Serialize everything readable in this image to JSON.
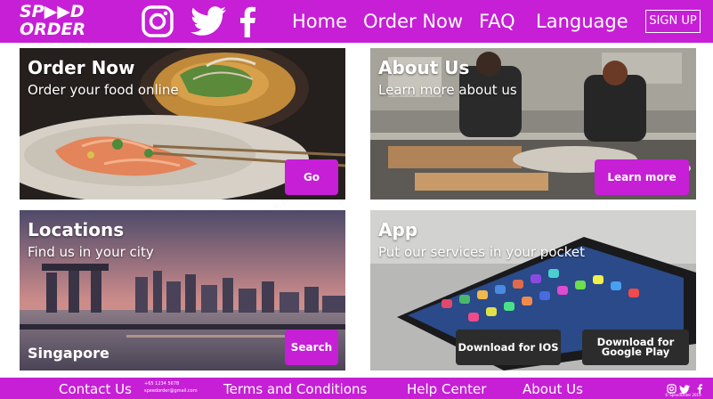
{
  "brand": {
    "logo_line1": "SP▶▶D",
    "logo_line2": "ORDER"
  },
  "header": {
    "social": [
      "instagram-icon",
      "twitter-icon",
      "facebook-icon"
    ],
    "nav": [
      "Home",
      "Order Now",
      "FAQ",
      "Language"
    ],
    "signup": "SIGN UP"
  },
  "cards": {
    "order": {
      "title": "Order Now",
      "subtitle": "Order your food online",
      "button": "Go"
    },
    "about": {
      "title": "About Us",
      "subtitle": "Learn more about us",
      "button": "Learn more"
    },
    "locations": {
      "title": "Locations",
      "subtitle": "Find us in your city",
      "city": "Singapore",
      "button": "Search"
    },
    "app": {
      "title": "App",
      "subtitle": "Put our services in your pocket",
      "button_ios": "Download for IOS",
      "button_play_1": "Download for",
      "button_play_2": "Google Play"
    }
  },
  "footer": {
    "contact": "Contact Us",
    "phone": "+65 1234 5678",
    "email": "speedorder@gmail.com",
    "terms": "Terms and Conditions",
    "help": "Help Center",
    "about": "About Us",
    "copyright": "© SpeedOrder 2019"
  },
  "colors": {
    "brand": "#c61fd6",
    "dark_button": "#2c2c2c"
  }
}
